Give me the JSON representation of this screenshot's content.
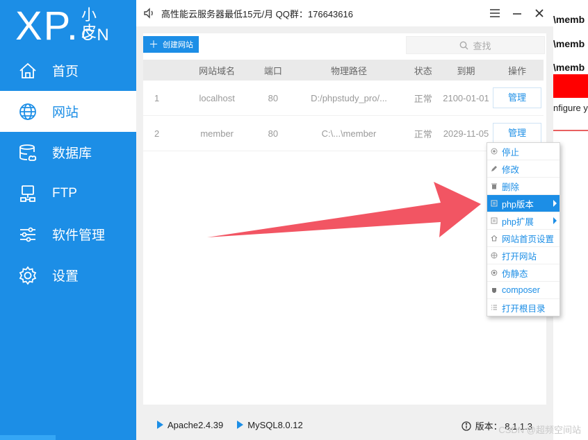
{
  "app": {
    "logo_main": "XP.",
    "logo_small": "小皮",
    "logo_cn": "CN",
    "title": "高性能云服务器最低15元/月  QQ群：176643616"
  },
  "sidebar": {
    "items": [
      {
        "label": "首页",
        "icon": "home-icon"
      },
      {
        "label": "网站",
        "icon": "globe-icon"
      },
      {
        "label": "数据库",
        "icon": "database-icon"
      },
      {
        "label": "FTP",
        "icon": "ftp-icon"
      },
      {
        "label": "软件管理",
        "icon": "sliders-icon"
      },
      {
        "label": "设置",
        "icon": "gear-icon"
      }
    ],
    "active": "网站"
  },
  "toolbar": {
    "create_label": "创建网站",
    "search_placeholder": "查找"
  },
  "table": {
    "headers": [
      "",
      "网站域名",
      "端口",
      "物理路径",
      "状态",
      "到期",
      "操作"
    ],
    "rows": [
      {
        "no": "1",
        "domain": "localhost",
        "port": "80",
        "path": "D:/phpstudy_pro/...",
        "status": "正常",
        "expire": "2100-01-01",
        "action": "管理"
      },
      {
        "no": "2",
        "domain": "member",
        "port": "80",
        "path": "C:\\...\\member",
        "status": "正常",
        "expire": "2029-11-05",
        "action": "管理"
      }
    ]
  },
  "context_menu": {
    "items": [
      {
        "label": "停止",
        "icon": "stop-icon"
      },
      {
        "label": "修改",
        "icon": "edit-icon"
      },
      {
        "label": "删除",
        "icon": "trash-icon"
      },
      {
        "label": "php版本",
        "icon": "php-icon",
        "submenu": true,
        "hover": true
      },
      {
        "label": "php扩展",
        "icon": "ext-icon",
        "submenu": true
      },
      {
        "label": "网站首页设置",
        "icon": "home-small-icon"
      },
      {
        "label": "打开网站",
        "icon": "globe-small-icon"
      },
      {
        "label": "伪静态",
        "icon": "rewrite-icon"
      },
      {
        "label": "composer",
        "icon": "composer-icon"
      },
      {
        "label": "打开根目录",
        "icon": "folder-list-icon"
      }
    ]
  },
  "status_bar": {
    "apache": "Apache2.4.39",
    "mysql": "MySQL8.0.12",
    "version": "版本： 8.1.1.3"
  },
  "background_window": {
    "lines": [
      "\\memb",
      "\\memb",
      "\\memb"
    ],
    "config_text": "nfigure y"
  },
  "watermark": "CSDN @超频空间站",
  "colors": {
    "accent": "#1c8ee6",
    "arrow": "#f25563",
    "error_red": "#ff0000"
  }
}
